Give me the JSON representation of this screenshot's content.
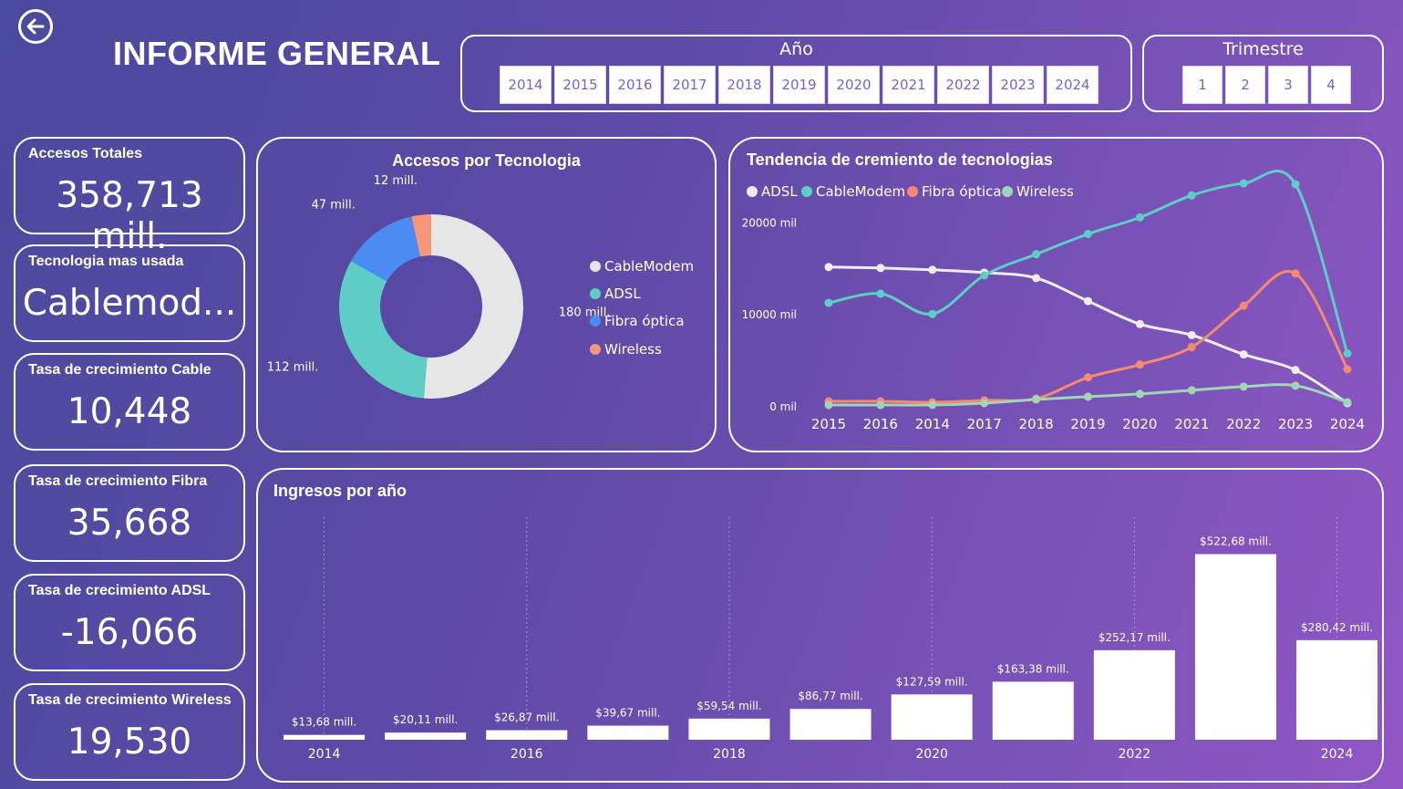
{
  "header": {
    "title": "INFORME GENERAL"
  },
  "slicer_year": {
    "title": "Año",
    "options": [
      "2014",
      "2015",
      "2016",
      "2017",
      "2018",
      "2019",
      "2020",
      "2021",
      "2022",
      "2023",
      "2024"
    ]
  },
  "slicer_quarter": {
    "title": "Trimestre",
    "options": [
      "1",
      "2",
      "3",
      "4"
    ]
  },
  "kpis": [
    {
      "label": "Accesos Totales",
      "value": "358,713 mill."
    },
    {
      "label": "Tecnologia mas usada",
      "value": "Cablemod..."
    },
    {
      "label": "Tasa de crecimiento Cable",
      "value": "10,448"
    },
    {
      "label": "Tasa de crecimiento Fibra",
      "value": "35,668"
    },
    {
      "label": "Tasa de crecimiento ADSL",
      "value": "-16,066"
    },
    {
      "label": "Tasa de crecimiento Wireless",
      "value": "19,530"
    }
  ],
  "donut": {
    "title": "Accesos por Tecnologia",
    "legend": [
      "CableModem",
      "ADSL",
      "Fibra óptica",
      "Wireless"
    ]
  },
  "line": {
    "title": "Tendencia de cremiento de tecnologias",
    "legend": [
      "ADSL",
      "CableModem",
      "Fibra óptica",
      "Wireless"
    ]
  },
  "bars": {
    "title": "Ingresos por año"
  },
  "colors": {
    "cablemodem": "#e6e6e6",
    "adsl_donut": "#5ecdc6",
    "fibra_donut": "#4b8cf2",
    "wireless_donut": "#f79779",
    "line_adsl": "#eeeeee",
    "line_cable": "#5ecdc6",
    "line_fibra": "#f48a72",
    "line_wireless": "#9fd6b5"
  },
  "chart_data": [
    {
      "type": "pie",
      "title": "Accesos por Tecnologia",
      "categories": [
        "CableModem",
        "ADSL",
        "Fibra óptica",
        "Wireless"
      ],
      "values": [
        180,
        112,
        47,
        12
      ],
      "labels": [
        "180 mill.",
        "112 mill.",
        "47 mill.",
        "12 mill."
      ]
    },
    {
      "type": "line",
      "title": "Tendencia de cremiento de tecnologias",
      "x": [
        "2015",
        "2016",
        "2014",
        "2017",
        "2018",
        "2019",
        "2020",
        "2021",
        "2022",
        "2023",
        "2024"
      ],
      "y_ticks": [
        0,
        10000,
        20000
      ],
      "y_tick_labels": [
        "0 mil",
        "10000 mil",
        "20000 mil"
      ],
      "ylim": [
        0,
        25000
      ],
      "series": [
        {
          "name": "ADSL",
          "values": [
            15200,
            15100,
            14900,
            14600,
            14000,
            11500,
            9000,
            7800,
            5700,
            4000,
            400
          ]
        },
        {
          "name": "CableModem",
          "values": [
            11300,
            12300,
            10100,
            14300,
            16600,
            18800,
            20600,
            23000,
            24300,
            24200,
            5800
          ]
        },
        {
          "name": "Fibra óptica",
          "values": [
            600,
            600,
            500,
            700,
            900,
            3200,
            4600,
            6500,
            11000,
            14500,
            4100
          ]
        },
        {
          "name": "Wireless",
          "values": [
            200,
            200,
            200,
            400,
            800,
            1100,
            1400,
            1800,
            2200,
            2300,
            500
          ]
        }
      ]
    },
    {
      "type": "bar",
      "title": "Ingresos por año",
      "categories": [
        "2014",
        "2015",
        "2016",
        "2017",
        "2018",
        "2019",
        "2020",
        "2021",
        "2022",
        "2023",
        "2024"
      ],
      "x_tick_labels": [
        "2014",
        "",
        "2016",
        "",
        "2018",
        "",
        "2020",
        "",
        "2022",
        "",
        "2024"
      ],
      "values": [
        13.68,
        20.11,
        26.87,
        39.67,
        59.54,
        86.77,
        127.59,
        163.38,
        252.17,
        522.68,
        280.42
      ],
      "labels": [
        "$13,68 mill.",
        "$20,11 mill.",
        "$26,87 mill.",
        "$39,67 mill.",
        "$59,54 mill.",
        "$86,77 mill.",
        "$127,59 mill.",
        "$163,38 mill.",
        "$252,17 mill.",
        "$522,68 mill.",
        "$280,42 mill."
      ],
      "ylim": [
        0,
        560
      ]
    }
  ]
}
